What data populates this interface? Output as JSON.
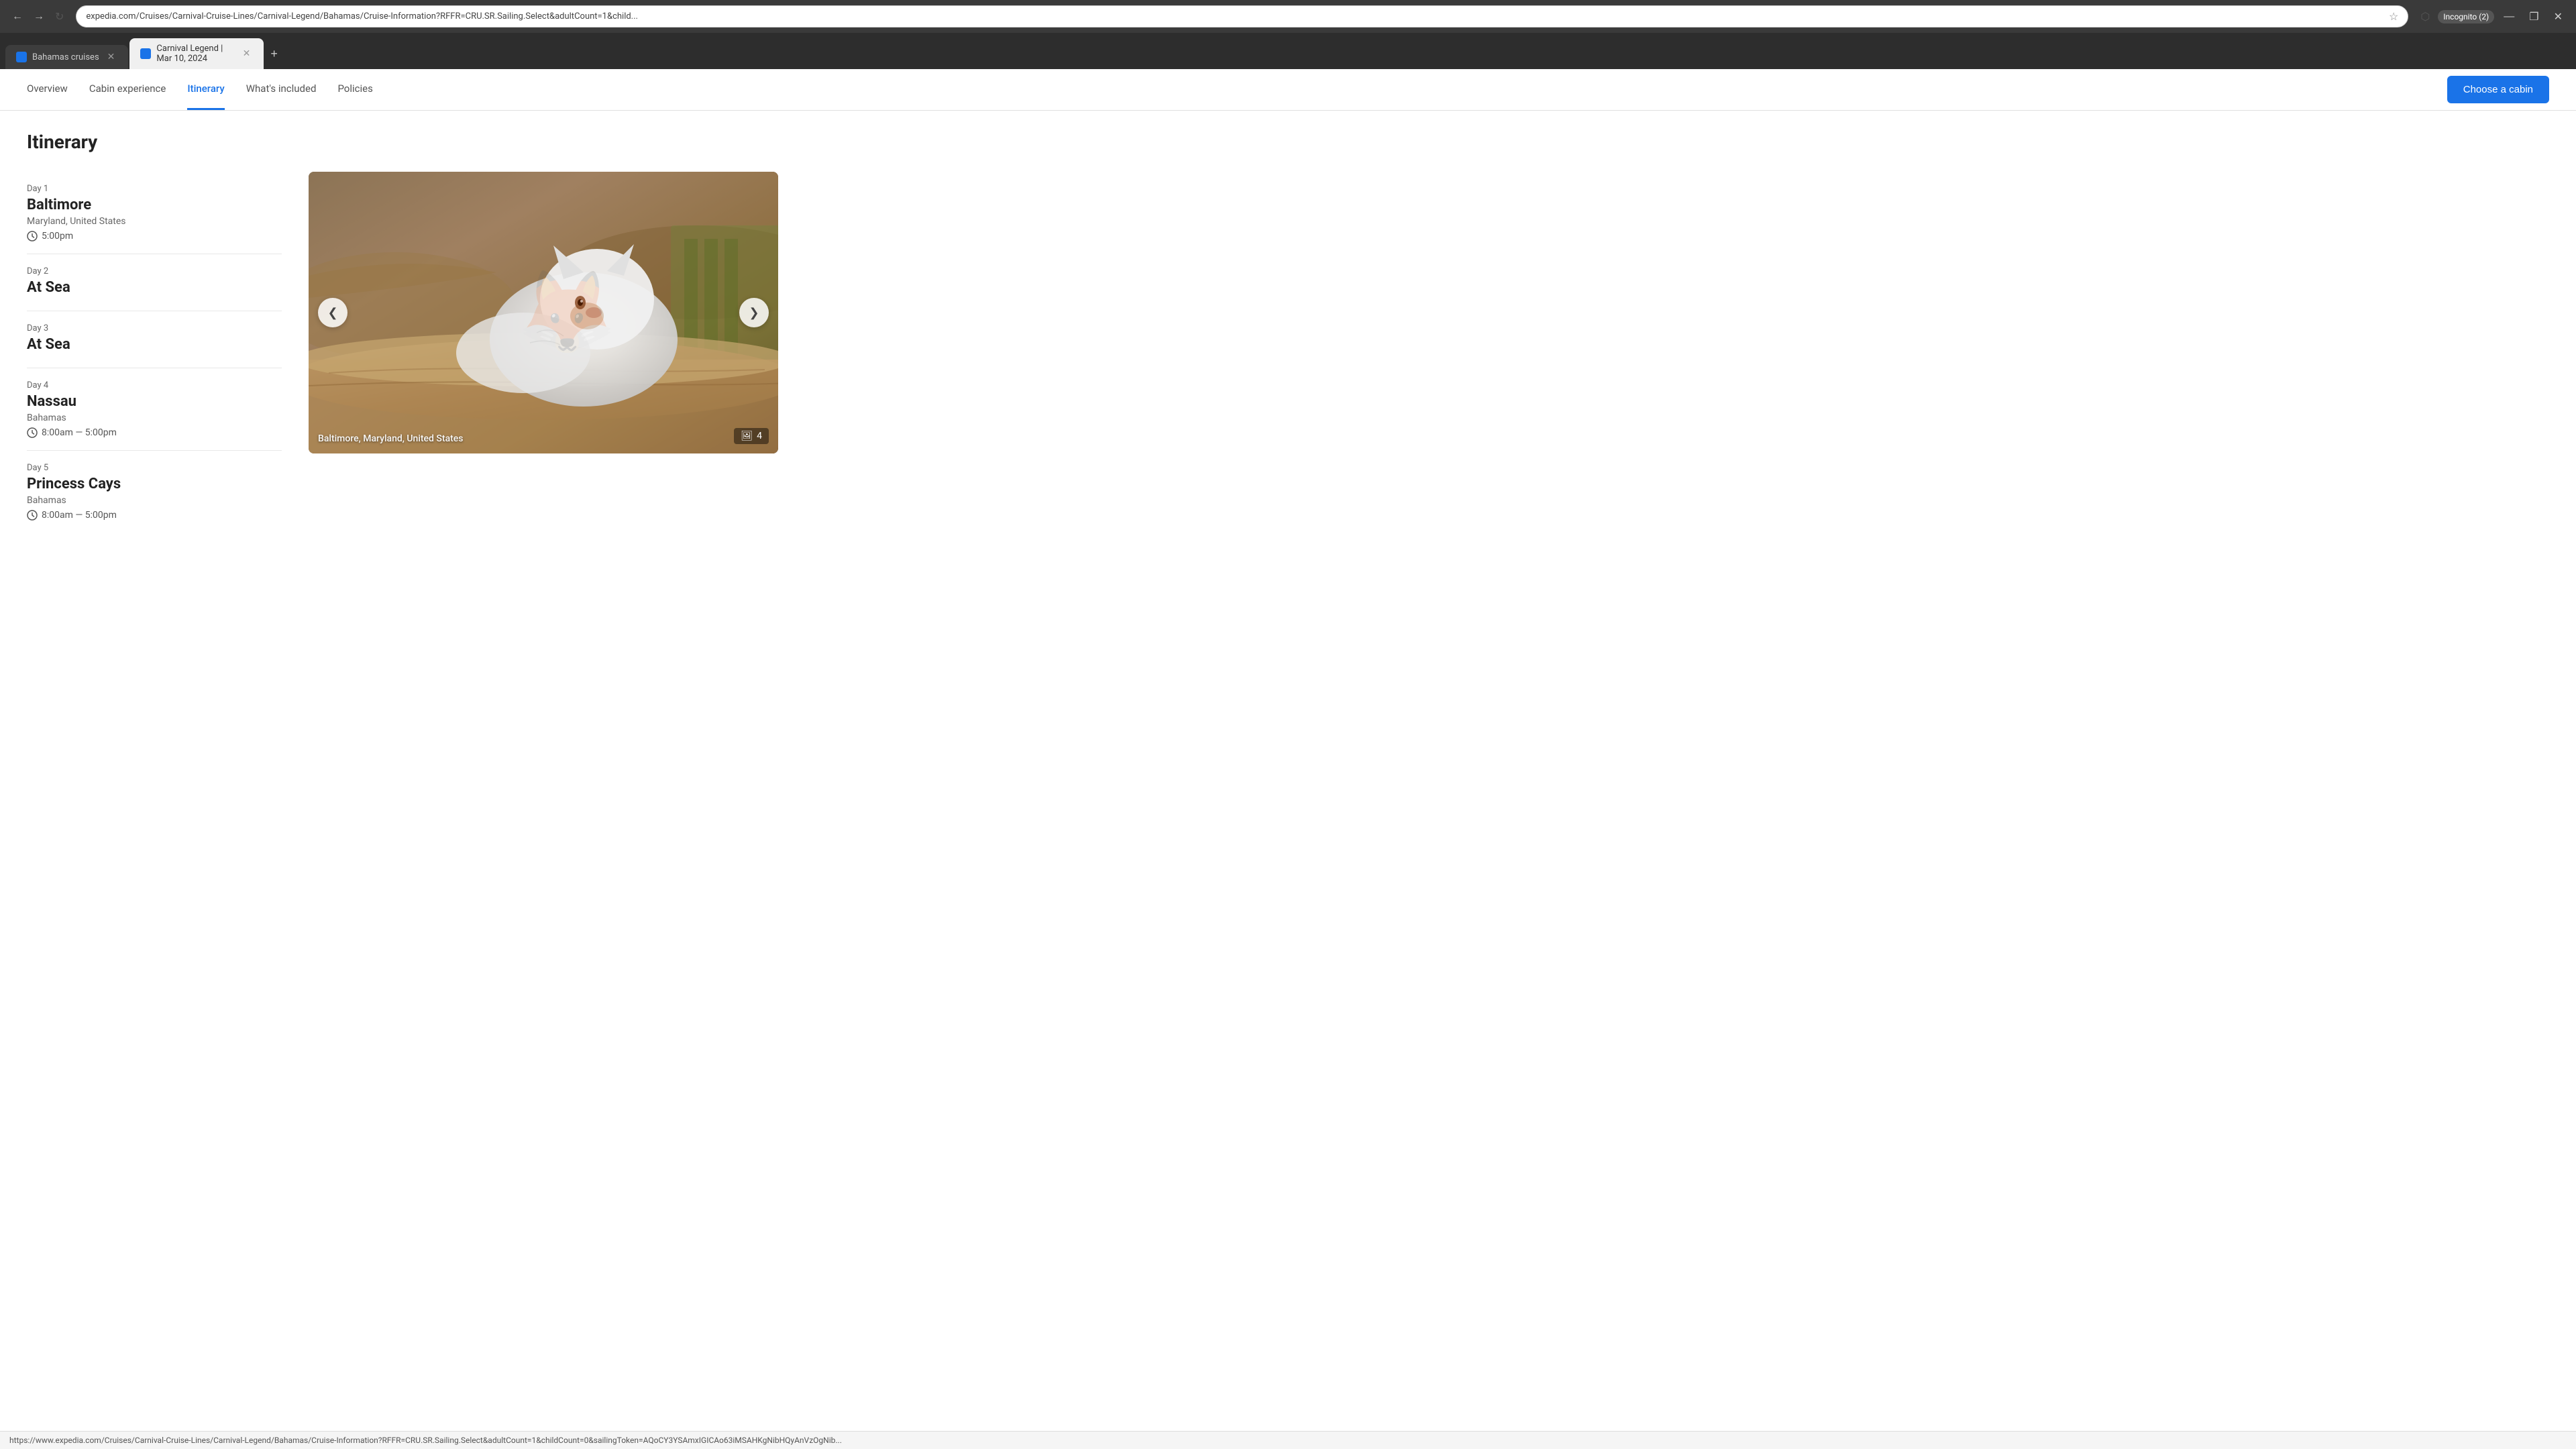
{
  "browser": {
    "tabs": [
      {
        "id": "tab1",
        "title": "Bahamas cruises",
        "active": false,
        "favicon": "🔷"
      },
      {
        "id": "tab2",
        "title": "Carnival Legend | Mar 10, 2024",
        "active": true,
        "favicon": "🔷"
      }
    ],
    "add_tab_label": "+",
    "address": "expedia.com/Cruises/Carnival-Cruise-Lines/Carnival-Legend/Bahamas/Cruise-Information?RFFR=CRU.SR.Sailing.Select&adultCount=1&child...",
    "nav_back": "←",
    "nav_forward": "→",
    "nav_refresh": "↻",
    "star_label": "☆",
    "profile_label": "Incognito (2)",
    "window_min": "—",
    "window_max": "❐",
    "window_close": "✕"
  },
  "nav": {
    "tabs": [
      {
        "id": "overview",
        "label": "Overview",
        "active": false
      },
      {
        "id": "cabin",
        "label": "Cabin experience",
        "active": false
      },
      {
        "id": "itinerary",
        "label": "Itinerary",
        "active": true
      },
      {
        "id": "included",
        "label": "What's included",
        "active": false
      },
      {
        "id": "policies",
        "label": "Policies",
        "active": false
      }
    ],
    "cta_label": "Choose a cabin"
  },
  "page": {
    "title": "Itinerary",
    "days": [
      {
        "day": "Day 1",
        "location": "Baltimore",
        "sublocation": "Maryland, United States",
        "time": "5:00pm",
        "time_type": "depart"
      },
      {
        "day": "Day 2",
        "location": "At Sea",
        "sublocation": "",
        "time": "",
        "time_type": ""
      },
      {
        "day": "Day 3",
        "location": "At Sea",
        "sublocation": "",
        "time": "",
        "time_type": ""
      },
      {
        "day": "Day 4",
        "location": "Nassau",
        "sublocation": "Bahamas",
        "time": "8:00am — 5:00pm",
        "time_type": "range"
      },
      {
        "day": "Day 5",
        "location": "Princess Cays",
        "sublocation": "Bahamas",
        "time": "8:00am — 5:00pm",
        "time_type": "range"
      }
    ],
    "image": {
      "caption": "Baltimore, Maryland, United States",
      "count": "4",
      "alt": "White fox resting on a log in Baltimore"
    },
    "prev_arrow": "❮",
    "next_arrow": "❯"
  },
  "status_bar": {
    "url": "https://www.expedia.com/Cruises/Carnival-Cruise-Lines/Carnival-Legend/Bahamas/Cruise-Information?RFFR=CRU.SR.Sailing.Select&adultCount=1&childCount=0&sailingToken=AQoCY3YSAmxIGICAo63iMSAHKgNibHQyAnVzOgNib..."
  }
}
